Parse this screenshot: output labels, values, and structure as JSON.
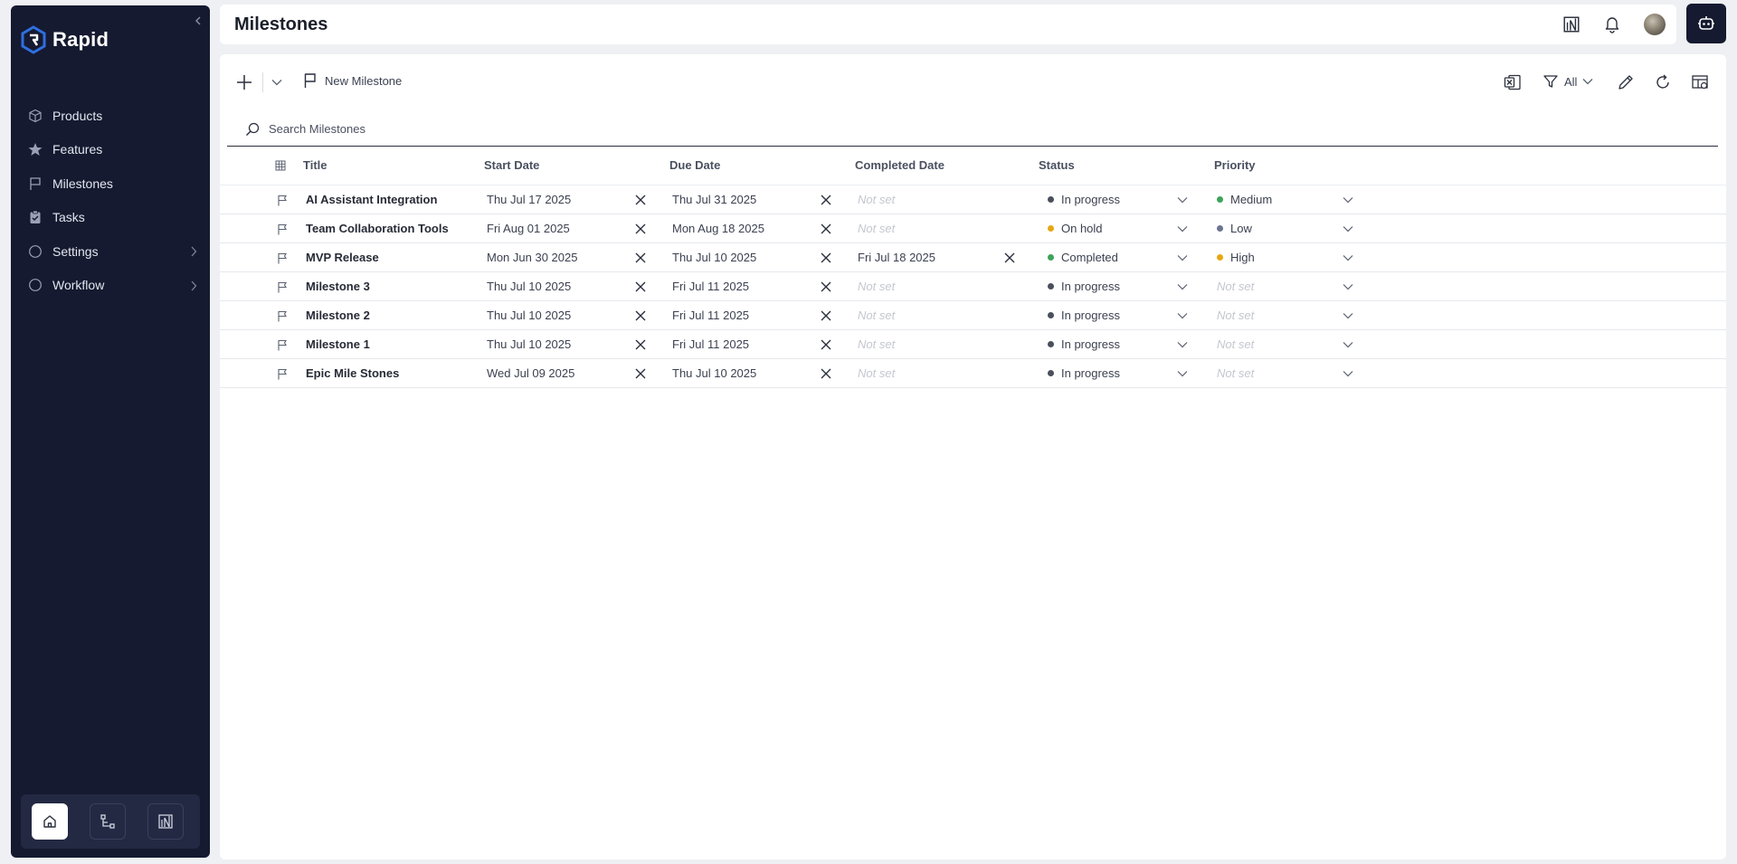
{
  "app": {
    "name": "Rapid"
  },
  "sidebar": {
    "items": [
      {
        "label": "Products",
        "icon": "cube-icon"
      },
      {
        "label": "Features",
        "icon": "star-icon"
      },
      {
        "label": "Milestones",
        "icon": "flag-icon"
      },
      {
        "label": "Tasks",
        "icon": "clipboard-icon"
      },
      {
        "label": "Settings",
        "icon": "circle-icon",
        "has_children": true
      },
      {
        "label": "Workflow",
        "icon": "circle-icon",
        "has_children": true
      }
    ],
    "bottom_buttons": [
      "home-icon",
      "workflow-diagram-icon",
      "chart-logo-icon"
    ]
  },
  "header": {
    "title": "Milestones"
  },
  "toolbar": {
    "new_label": "New Milestone",
    "filter_label": "All"
  },
  "search": {
    "placeholder": "Search Milestones"
  },
  "table": {
    "columns": [
      "Title",
      "Start Date",
      "Due Date",
      "Completed Date",
      "Status",
      "Priority"
    ],
    "not_set": "Not set",
    "rows": [
      {
        "title": "AI Assistant Integration",
        "start": "Thu Jul 17 2025",
        "due": "Thu Jul 31 2025",
        "completed": "Not set",
        "status": "In progress",
        "status_color": "#4a4f5c",
        "priority": "Medium",
        "priority_color": "#3fa35a"
      },
      {
        "title": "Team Collaboration Tools",
        "start": "Fri Aug 01 2025",
        "due": "Mon Aug 18 2025",
        "completed": "Not set",
        "status": "On hold",
        "status_color": "#e7a715",
        "priority": "Low",
        "priority_color": "#6b7590"
      },
      {
        "title": "MVP Release",
        "start": "Mon Jun 30 2025",
        "due": "Thu Jul 10 2025",
        "completed": "Fri Jul 18 2025",
        "status": "Completed",
        "status_color": "#3fa35a",
        "priority": "High",
        "priority_color": "#e7a715"
      },
      {
        "title": "Milestone 3",
        "start": "Thu Jul 10 2025",
        "due": "Fri Jul 11 2025",
        "completed": "Not set",
        "status": "In progress",
        "status_color": "#4a4f5c",
        "priority": "Not set",
        "priority_color": ""
      },
      {
        "title": "Milestone 2",
        "start": "Thu Jul 10 2025",
        "due": "Fri Jul 11 2025",
        "completed": "Not set",
        "status": "In progress",
        "status_color": "#4a4f5c",
        "priority": "Not set",
        "priority_color": ""
      },
      {
        "title": "Milestone 1",
        "start": "Thu Jul 10 2025",
        "due": "Fri Jul 11 2025",
        "completed": "Not set",
        "status": "In progress",
        "status_color": "#4a4f5c",
        "priority": "Not set",
        "priority_color": ""
      },
      {
        "title": "Epic Mile Stones",
        "start": "Wed Jul 09 2025",
        "due": "Thu Jul 10 2025",
        "completed": "Not set",
        "status": "In progress",
        "status_color": "#4a4f5c",
        "priority": "Not set",
        "priority_color": ""
      }
    ]
  },
  "colors": {
    "sidebar_bg": "#151a30",
    "accent": "#2f6fe0",
    "page_bg": "#eef0f3"
  }
}
